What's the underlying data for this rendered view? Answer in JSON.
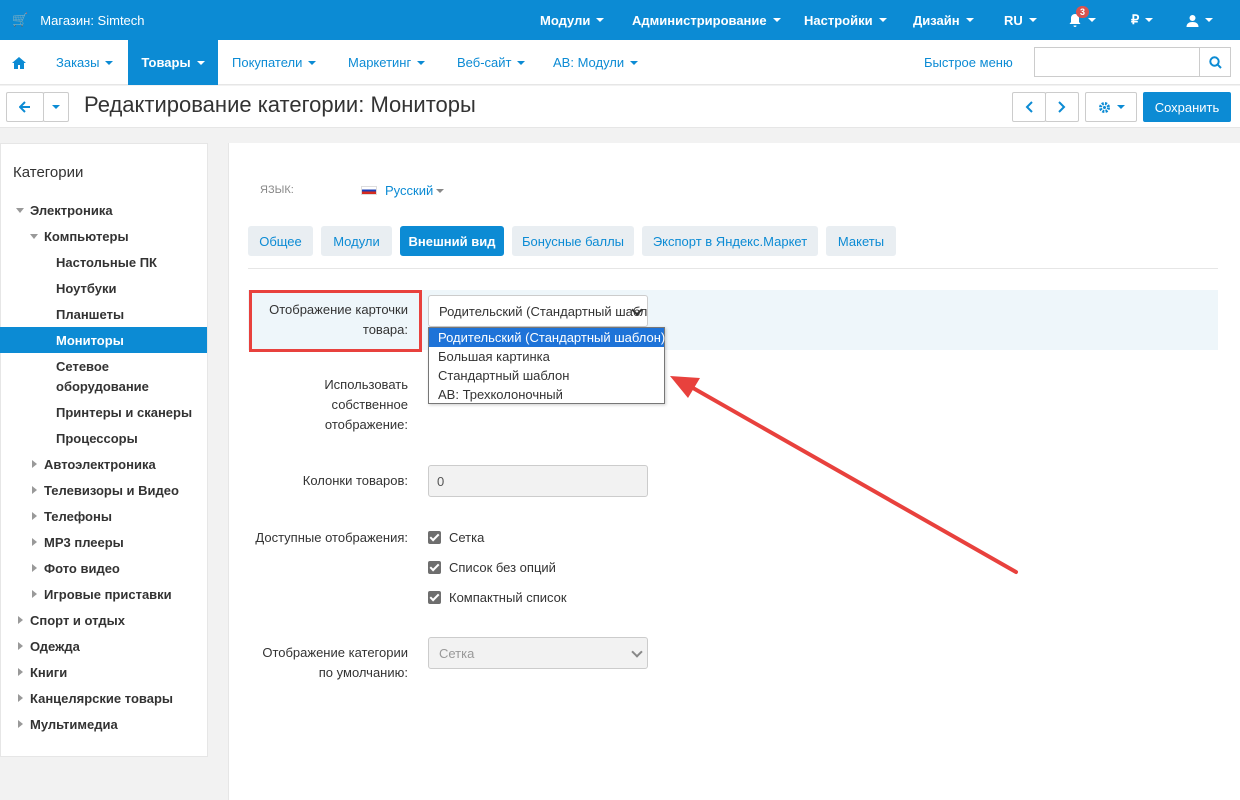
{
  "topbar": {
    "store": "Магазин: Simtech",
    "nav": [
      "Модули",
      "Администрирование",
      "Настройки",
      "Дизайн",
      "RU"
    ],
    "notifications_count": "3",
    "currency": "₽"
  },
  "nav2": {
    "items": [
      "Заказы",
      "Товары",
      "Покупатели",
      "Маркетинг",
      "Веб-сайт",
      "AB: Модули"
    ],
    "quick_menu": "Быстрое меню",
    "search_placeholder": ""
  },
  "title": {
    "text": "Редактирование категории: Мониторы",
    "save": "Сохранить"
  },
  "sidebar": {
    "heading": "Категории",
    "items": [
      "Электроника",
      "Компьютеры",
      "Настольные ПК",
      "Ноутбуки",
      "Планшеты",
      "Мониторы",
      "Сетевое",
      "оборудование",
      "Принтеры и сканеры",
      "Процессоры",
      "Автоэлектроника",
      "Телевизоры и Видео",
      "Телефоны",
      "MP3 плееры",
      "Фото видео",
      "Игровые приставки",
      "Спорт и отдых",
      "Одежда",
      "Книги",
      "Канцелярские товары",
      "Мультимедиа"
    ]
  },
  "main": {
    "lang_label": "ЯЗЫК:",
    "lang_value": "Русский",
    "tabs": [
      "Общее",
      "Модули",
      "Внешний вид",
      "Бонусные баллы",
      "Экспорт в Яндекс.Маркет",
      "Макеты"
    ],
    "card_label_1": "Отображение карточки",
    "card_label_2": "товара:",
    "card_select_value": "Родительский (Стандартный шаблон)",
    "dropdown_options": [
      "Родительский (Стандартный шаблон)",
      "Большая картинка",
      "Стандартный шаблон",
      "AB: Трехколоночный"
    ],
    "own_label": [
      "Использовать",
      "собственное",
      "отображение:"
    ],
    "columns_label": "Колонки товаров:",
    "columns_value": "0",
    "views_label": "Доступные отображения:",
    "views": [
      "Сетка",
      "Список без опций",
      "Компактный список"
    ],
    "default_label_1": "Отображение категории",
    "default_label_2": "по умолчанию:",
    "default_value": "Сетка"
  },
  "colors": {
    "brand": "#0c8bd4",
    "highlight": "#e8413d"
  }
}
